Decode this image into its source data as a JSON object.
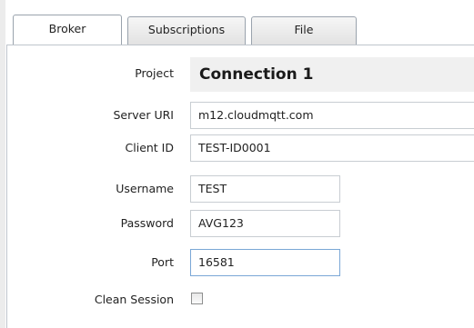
{
  "tabs": [
    {
      "label": "Broker",
      "active": true
    },
    {
      "label": "Subscriptions",
      "active": false
    },
    {
      "label": "File",
      "active": false
    }
  ],
  "form": {
    "project_label": "Project",
    "project_value": "Connection 1",
    "server_uri_label": "Server URI",
    "server_uri_value": "m12.cloudmqtt.com",
    "client_id_label": "Client ID",
    "client_id_value": "TEST-ID0001",
    "username_label": "Username",
    "username_value": "TEST",
    "password_label": "Password",
    "password_value": "AVG123",
    "port_label": "Port",
    "port_value": "16581",
    "clean_session_label": "Clean Session",
    "clean_session_checked": false
  },
  "colors": {
    "tab_border": "#9aa3ad",
    "field_border": "#c8cdd2",
    "focus_border": "#7aa7d6",
    "project_bg": "#f0f0f0"
  }
}
